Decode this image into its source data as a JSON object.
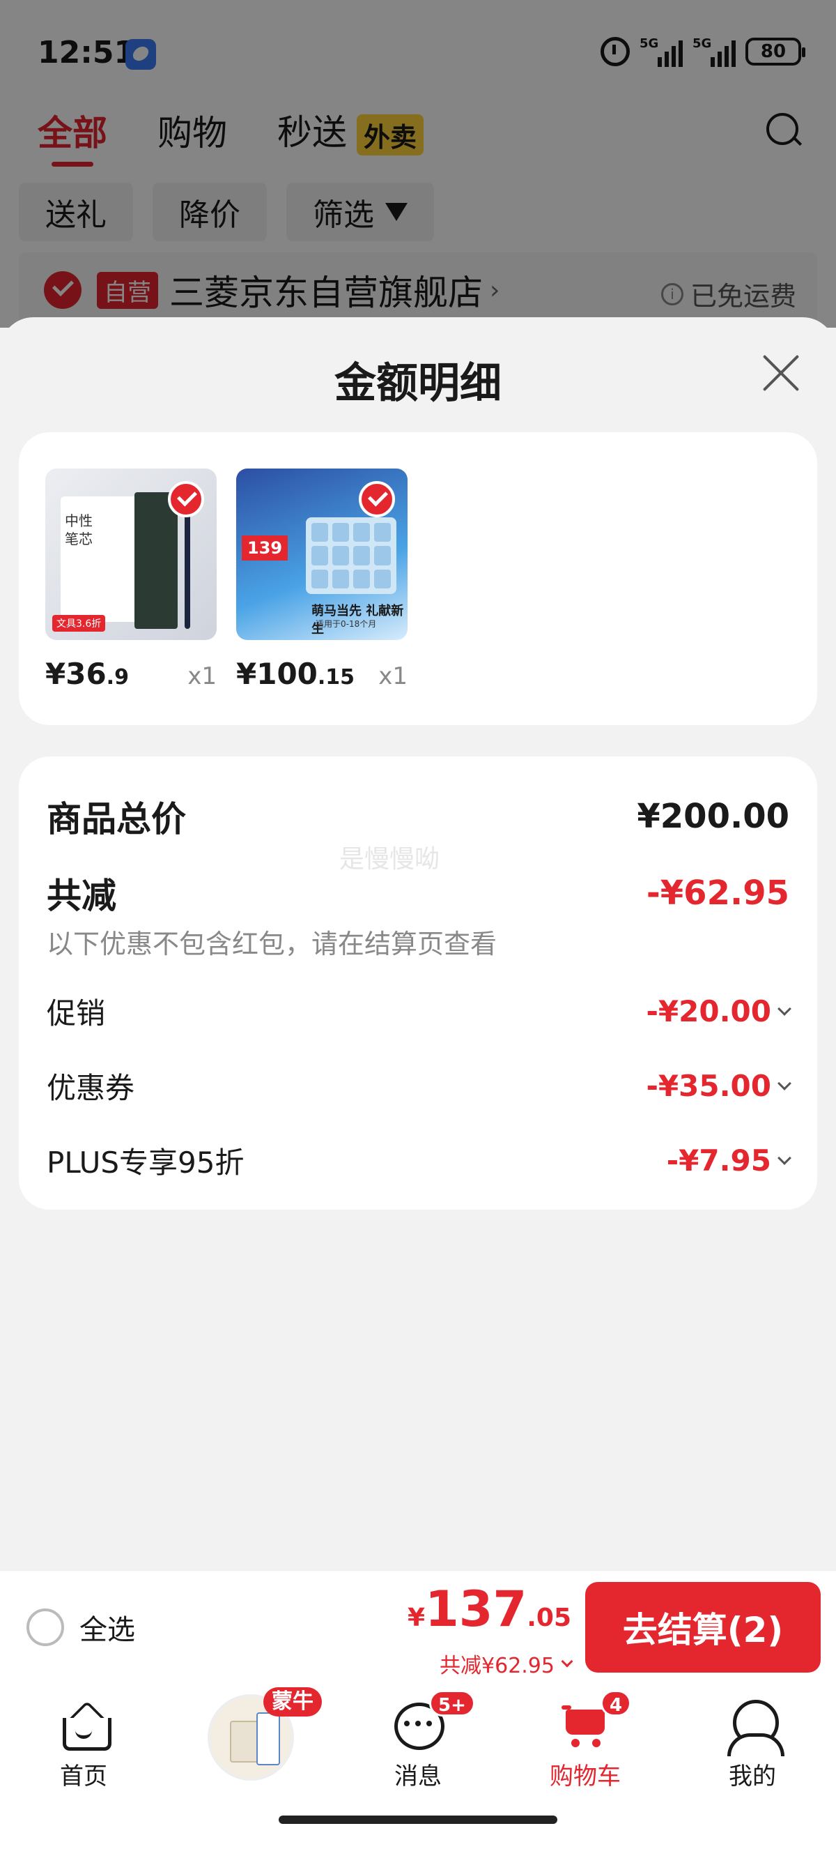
{
  "status_bar": {
    "time": "12:51",
    "network_1": "5G",
    "network_2": "5G",
    "battery": "80"
  },
  "top_tabs": [
    {
      "label": "全部",
      "active": true
    },
    {
      "label": "购物",
      "active": false
    },
    {
      "label": "秒送",
      "active": false,
      "badge": "外卖"
    }
  ],
  "filters": [
    "送礼",
    "降价",
    "筛选"
  ],
  "store": {
    "badge": "自营",
    "name": "三菱京东自营旗舰店",
    "chevron": "›",
    "shipping": "已免运费",
    "info_glyph": "i"
  },
  "sheet": {
    "title": "金额明细",
    "goods": [
      {
        "price_main": "¥36",
        "price_decimal": ".9",
        "qty": "x1",
        "image_text": [
          "中性",
          "笔芯"
        ],
        "image_tag": "文具3.6折"
      },
      {
        "price_main": "¥100",
        "price_decimal": ".15",
        "qty": "x1",
        "image_price": "139",
        "image_caption": "萌马当先 礼献新生",
        "image_sub": "适用于0-18个月"
      }
    ],
    "summary": {
      "total_label": "商品总价",
      "total_value": "¥200.00",
      "reduce_label": "共减",
      "reduce_value": "-¥62.95",
      "watermark": "是慢慢呦",
      "hint": "以下优惠不包含红包，请在结算页查看",
      "items": [
        {
          "label": "促销",
          "value": "-¥20.00"
        },
        {
          "label": "优惠券",
          "value": "-¥35.00"
        },
        {
          "label": "PLUS专享95折",
          "value": "-¥7.95"
        }
      ]
    }
  },
  "checkout": {
    "select_all": "全选",
    "currency": "¥",
    "total_int": "137",
    "total_dec": ".05",
    "reduce_text": "共减¥62.95",
    "button": "去结算(2)"
  },
  "bottom_nav": {
    "home": "首页",
    "promo_badge": "蒙牛",
    "message": "消息",
    "message_badge": "5+",
    "cart": "购物车",
    "cart_badge": "4",
    "me": "我的"
  },
  "colors": {
    "accent": "#e4262e",
    "background": "#f2f2f2",
    "card": "#ffffff",
    "badge_yellow": "#ffd43b"
  },
  "icons": [
    "app-icon",
    "alarm-icon",
    "signal-icon",
    "battery-icon",
    "search-icon",
    "funnel-icon",
    "check-icon",
    "info-icon",
    "close-icon",
    "chevron-down-icon",
    "home-icon",
    "message-icon",
    "cart-icon",
    "profile-icon"
  ]
}
